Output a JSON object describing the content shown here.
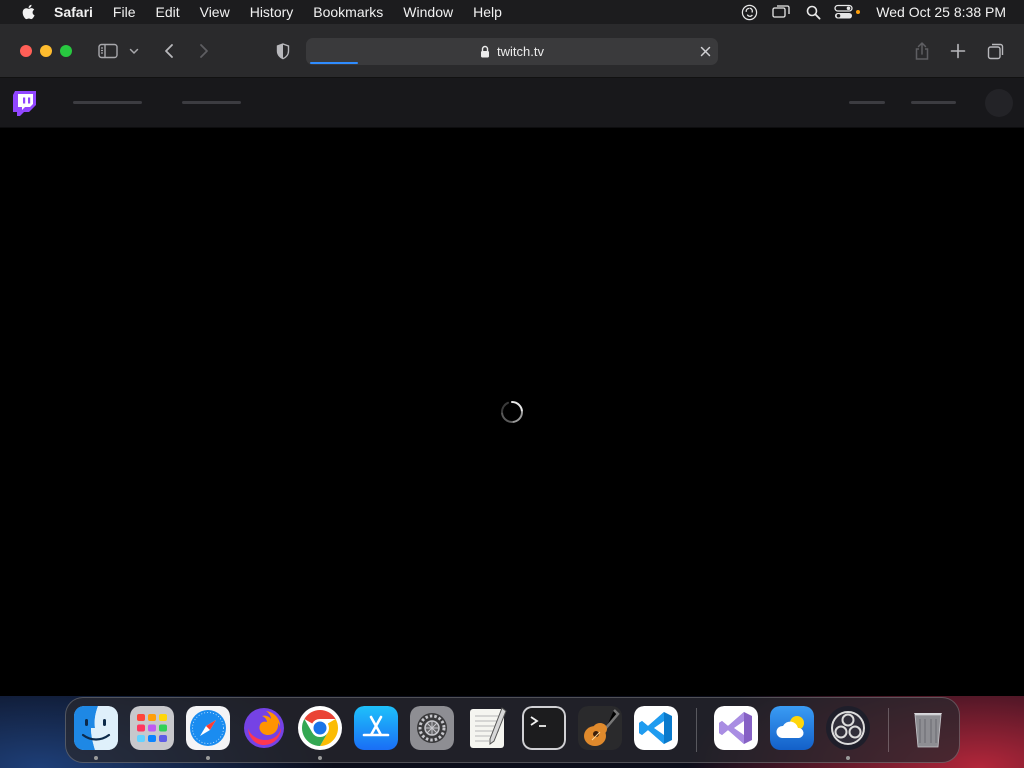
{
  "menubar": {
    "app_name": "Safari",
    "items": [
      "File",
      "Edit",
      "View",
      "History",
      "Bookmarks",
      "Window",
      "Help"
    ],
    "clock": "Wed Oct 25  8:38 PM",
    "status_icons": [
      "obs-status-icon",
      "screen-mirroring-icon",
      "spotlight-search-icon",
      "control-center-icon"
    ]
  },
  "browser": {
    "url": "twitch.tv",
    "load_progress_percent": 12,
    "colors": {
      "progress": "#2f8cff",
      "toolbar": "#2a2a2c"
    }
  },
  "site": {
    "brand_color": "#9146ff",
    "state": "loading"
  },
  "dock": {
    "apps": [
      {
        "name": "finder-icon",
        "running": true
      },
      {
        "name": "launchpad-icon",
        "running": false
      },
      {
        "name": "safari-icon",
        "running": true
      },
      {
        "name": "firefox-icon",
        "running": false
      },
      {
        "name": "chrome-icon",
        "running": true
      },
      {
        "name": "app-store-icon",
        "running": false
      },
      {
        "name": "system-settings-icon",
        "running": false
      },
      {
        "name": "textedit-icon",
        "running": false
      },
      {
        "name": "terminal-icon",
        "running": false
      },
      {
        "name": "garageband-icon",
        "running": false
      },
      {
        "name": "vscode-icon",
        "running": false
      },
      {
        "name": "visual-studio-icon",
        "running": false
      },
      {
        "name": "weather-icon",
        "running": false
      },
      {
        "name": "obs-icon",
        "running": true
      }
    ],
    "trash": "trash-icon"
  }
}
